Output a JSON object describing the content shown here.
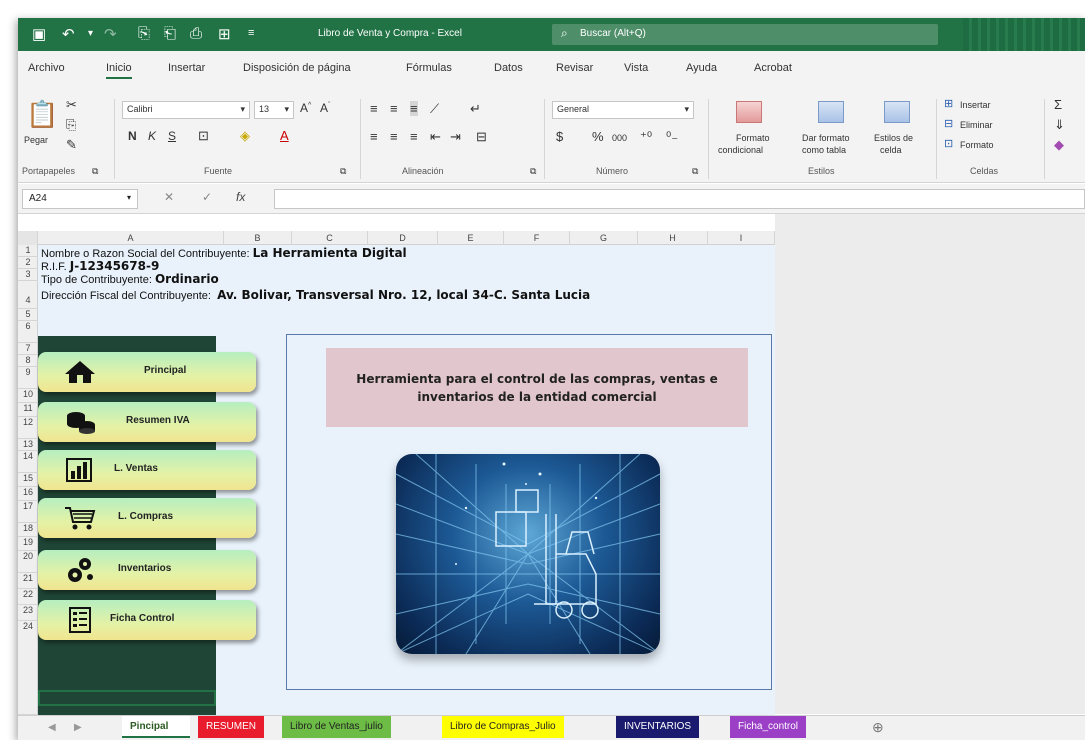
{
  "titlebar": {
    "title": "Libro de Venta y Compra - Excel",
    "search_placeholder": "Buscar (Alt+Q)"
  },
  "menu": [
    "Archivo",
    "Inicio",
    "Insertar",
    "Disposición de página",
    "Fórmulas",
    "Datos",
    "Revisar",
    "Vista",
    "Ayuda",
    "Acrobat"
  ],
  "ribbon": {
    "paste_label": "Pegar",
    "font_name": "Calibri",
    "font_size": "13",
    "bold": "N",
    "italic": "K",
    "underline": "S",
    "number_format": "General",
    "percent": "%",
    "thousands": "000",
    "cond_format_1": "Formato",
    "cond_format_2": "condicional",
    "table_format_1": "Dar formato",
    "table_format_2": "como tabla",
    "cell_styles_1": "Estilos de",
    "cell_styles_2": "celda",
    "insert": "Insertar",
    "delete": "Eliminar",
    "format": "Formato",
    "groups": {
      "clipboard": "Portapapeles",
      "font": "Fuente",
      "alignment": "Alineación",
      "number": "Número",
      "styles": "Estilos",
      "cells": "Celdas"
    }
  },
  "formula": {
    "cell_ref": "A24",
    "fx": "fx"
  },
  "columns": [
    "A",
    "B",
    "C",
    "D",
    "E",
    "F",
    "G",
    "H",
    "I"
  ],
  "rows": [
    "1",
    "2",
    "3",
    "4",
    "5",
    "6",
    "7",
    "8",
    "9",
    "10",
    "11",
    "12",
    "13",
    "14",
    "15",
    "16",
    "17",
    "18",
    "19",
    "20",
    "21",
    "22",
    "23",
    "24"
  ],
  "info": {
    "name_label": "Nombre o Razon Social del Contribuyente:",
    "name_value": "La Herramienta Digital",
    "rif_label": "R.I.F.",
    "rif_value": "J-12345678-9",
    "type_label": "Tipo de Contribuyente:",
    "type_value": "Ordinario",
    "address_label": "Dirección Fiscal del Contribuyente:",
    "address_value": "Av. Bolivar, Transversal Nro. 12, local 34-C. Santa Lucia"
  },
  "nav": [
    {
      "label": "Principal",
      "icon": "home-icon"
    },
    {
      "label": "Resumen IVA",
      "icon": "coins-icon"
    },
    {
      "label": "L. Ventas",
      "icon": "bar-chart-icon"
    },
    {
      "label": "L. Compras",
      "icon": "cart-icon"
    },
    {
      "label": "Inventarios",
      "icon": "gears-icon"
    },
    {
      "label": "Ficha Control",
      "icon": "checklist-icon"
    }
  ],
  "headline": "Herramienta para el control de las compras, ventas e inventarios de la entidad comercial",
  "tabs": [
    {
      "label": "Pincipal",
      "bg": "#4a7a3a",
      "color": "#ffffff"
    },
    {
      "label": "RESUMEN",
      "bg": "#e81c2c",
      "color": "#ffffff"
    },
    {
      "label": "Libro de Ventas_julio",
      "bg": "#6cbc46",
      "color": "#222222"
    },
    {
      "label": "Libro de Compras_Julio",
      "bg": "#ffff00",
      "color": "#222222"
    },
    {
      "label": "INVENTARIOS",
      "bg": "#1a1a6e",
      "color": "#ffffff"
    },
    {
      "label": "Ficha_control",
      "bg": "#9b3fc7",
      "color": "#ffffff"
    }
  ],
  "colors": {
    "excel_green": "#217346",
    "dark_panel": "#1f4536",
    "headline_bg": "#e1c6cd"
  }
}
